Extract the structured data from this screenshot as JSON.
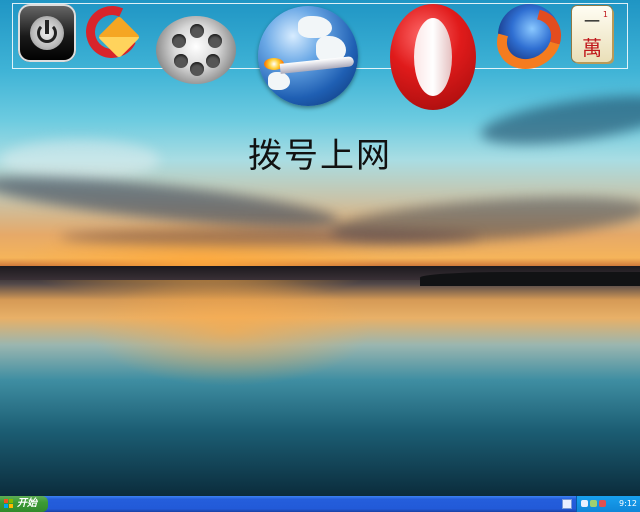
{
  "desktop": {
    "caption": "拨号上网",
    "icons": [
      {
        "name": "power-icon"
      },
      {
        "name": "ccleaner-icon"
      },
      {
        "name": "film-reel-icon"
      },
      {
        "name": "globe-rocket-icon"
      },
      {
        "name": "opera-icon"
      },
      {
        "name": "firefox-icon"
      },
      {
        "name": "mahjong-tile-icon",
        "tile_top": "一",
        "tile_bottom": "萬",
        "tile_corner": "1"
      }
    ]
  },
  "taskbar": {
    "start_label": "开始",
    "clock": "9:12",
    "colors": {
      "taskbar": "#245edc",
      "start": "#3c9b35",
      "tray": "#0f86d8"
    }
  }
}
